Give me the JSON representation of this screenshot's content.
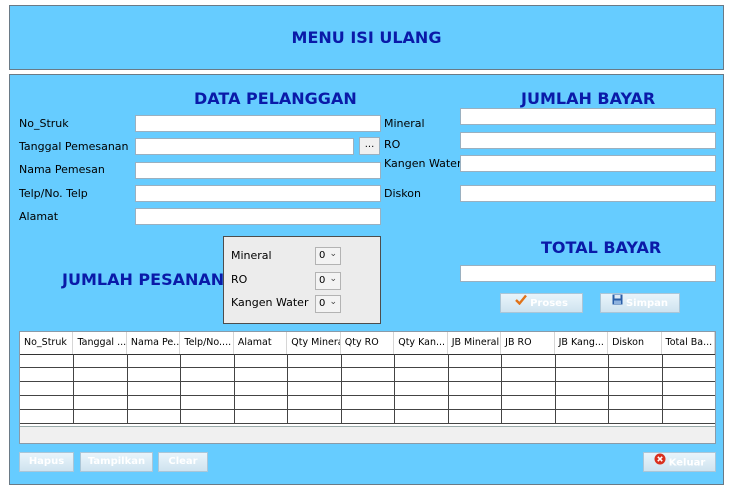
{
  "header": {
    "title": "MENU ISI ULANG"
  },
  "customer": {
    "title": "DATA PELANGGAN",
    "no_struk_label": "No_Struk",
    "tanggal_label": "Tanggal Pemesanan",
    "date_picker_label": "...",
    "nama_label": "Nama Pemesan",
    "telp_label": "Telp/No. Telp",
    "alamat_label": "Alamat"
  },
  "order": {
    "title": "JUMLAH PESANAN",
    "mineral_label": "Mineral",
    "mineral_value": "0",
    "ro_label": "RO",
    "ro_value": "0",
    "kangen_label": "Kangen Water",
    "kangen_value": "0"
  },
  "payment": {
    "title": "JUMLAH BAYAR",
    "mineral_label": "Mineral",
    "ro_label": "RO",
    "kangen_label": "Kangen Water",
    "diskon_label": "Diskon"
  },
  "total": {
    "title": "TOTAL BAYAR"
  },
  "actions": {
    "proses": "Proses",
    "simpan": "Simpan"
  },
  "table": {
    "columns": [
      "No_Struk",
      "Tanggal ...",
      "Nama Pe...",
      "Telp/No....",
      "Alamat",
      "Qty Mineral",
      "Qty RO",
      "Qty Kan...",
      "JB Mineral",
      "JB RO",
      "JB Kang...",
      "Diskon",
      "Total Ba..."
    ]
  },
  "footer": {
    "hapus": "Hapus",
    "tampilkan": "Tampilkan",
    "clear": "Clear",
    "keluar": "Keluar"
  },
  "colors": {
    "panel": "#66ccff",
    "title": "#0a1aa8",
    "proses_icon": "#e0731a",
    "simpan_icon": "#2a5ea8",
    "keluar_icon": "#d9301e"
  },
  "icons": {
    "proses": "check-icon",
    "simpan": "floppy-disk-icon",
    "keluar": "close-circle-icon",
    "spin_arrow": "chevron-down-icon"
  }
}
